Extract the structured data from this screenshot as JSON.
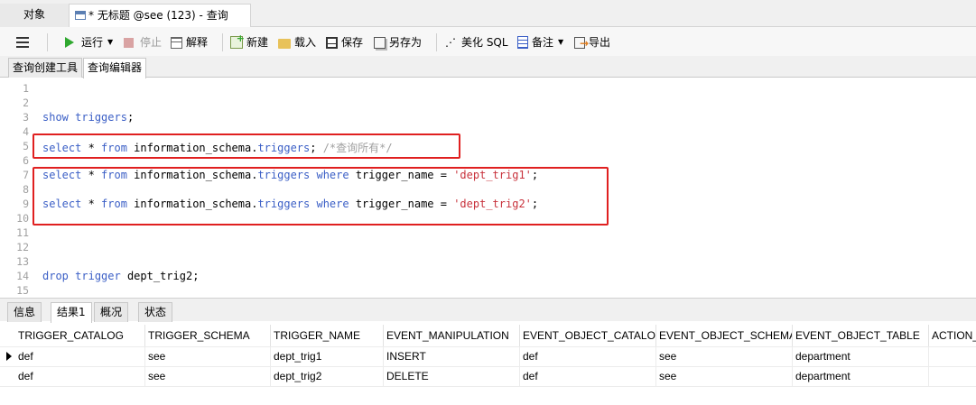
{
  "tabs": {
    "objects": "对象",
    "query": "* 无标题 @see (123) - 查询"
  },
  "toolbar": {
    "run": "运行",
    "stop": "停止",
    "explain": "解释",
    "new": "新建",
    "load": "载入",
    "save": "保存",
    "save_as": "另存为",
    "beautify": "美化 SQL",
    "comment": "备注",
    "export": "导出"
  },
  "subtabs": {
    "builder": "查询创建工具",
    "editor": "查询编辑器"
  },
  "editor": {
    "line_numbers": [
      "1",
      "2",
      "3",
      "4",
      "5",
      "6",
      "7",
      "8",
      "9",
      "10",
      "11",
      "12",
      "13",
      "14",
      "15"
    ],
    "line3": {
      "kw1": "show",
      "kw2": "triggers",
      "end": ";"
    },
    "line5": {
      "kw1": "select",
      "mid1": " * ",
      "kw2": "from",
      "mid2": " information_schema.",
      "kw3": "triggers",
      "end": "; ",
      "comment": "/*查询所有*/"
    },
    "line7": {
      "kw1": "select",
      "mid1": " * ",
      "kw2": "from",
      "mid2": " information_schema.",
      "kw3": "triggers",
      "sp": " ",
      "kw4": "where",
      "mid3": " trigger_name = ",
      "str": "'dept_trig1'",
      "end": ";"
    },
    "line9": {
      "kw1": "select",
      "mid1": " * ",
      "kw2": "from",
      "mid2": " information_schema.",
      "kw3": "triggers",
      "sp": " ",
      "kw4": "where",
      "mid3": " trigger_name = ",
      "str": "'dept_trig2'",
      "end": ";"
    },
    "line14": {
      "kw1": "drop",
      "sp": " ",
      "kw2": "trigger",
      "rest": " dept_trig2;"
    }
  },
  "result_tabs": [
    "信息",
    "结果1",
    "概况",
    "状态"
  ],
  "grid": {
    "columns": [
      "TRIGGER_CATALOG",
      "TRIGGER_SCHEMA",
      "TRIGGER_NAME",
      "EVENT_MANIPULATION",
      "EVENT_OBJECT_CATALOG",
      "EVENT_OBJECT_SCHEMA",
      "EVENT_OBJECT_TABLE",
      "ACTION_"
    ],
    "rows": [
      [
        "def",
        "see",
        "dept_trig1",
        "INSERT",
        "def",
        "see",
        "department",
        ""
      ],
      [
        "def",
        "see",
        "dept_trig2",
        "DELETE",
        "def",
        "see",
        "department",
        ""
      ]
    ]
  },
  "colors": {
    "highlight": "#e02020",
    "keyword": "#3b5fc6",
    "string": "#c8323c",
    "run_icon": "#2fa82f"
  }
}
